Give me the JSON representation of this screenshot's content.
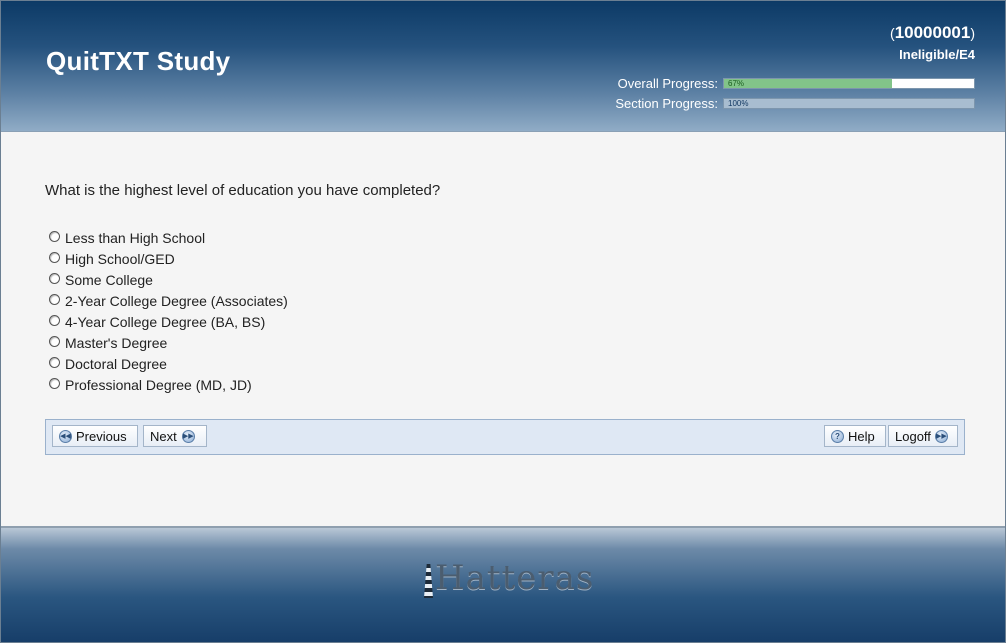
{
  "header": {
    "study_title": "QuitTXT Study",
    "participant_id": "10000001",
    "status": "Ineligible/E4",
    "overall_progress": {
      "label": "Overall Progress:",
      "value": 67,
      "text": "67%"
    },
    "section_progress": {
      "label": "Section Progress:",
      "value": 100,
      "text": "100%"
    }
  },
  "question": {
    "text": "What is the highest level of education you have completed?",
    "options": [
      "Less than High School",
      "High School/GED",
      "Some College",
      "2-Year College Degree (Associates)",
      "4-Year College Degree (BA, BS)",
      "Master's Degree",
      "Doctoral Degree",
      "Professional Degree (MD, JD)"
    ]
  },
  "nav": {
    "previous_label": "Previous",
    "next_label": "Next",
    "help_label": "Help",
    "logoff_label": "Logoff"
  },
  "footer": {
    "logo_text": "Hatteras"
  },
  "icons": {
    "previous": "rewind-icon",
    "next": "fast-forward-icon",
    "help": "help-icon",
    "logoff": "fast-forward-icon",
    "logo": "lighthouse-icon"
  },
  "colors": {
    "header_top": "#0c3a66",
    "progress_fill": "#82c489",
    "nav_bar": "#dfe8f4"
  }
}
